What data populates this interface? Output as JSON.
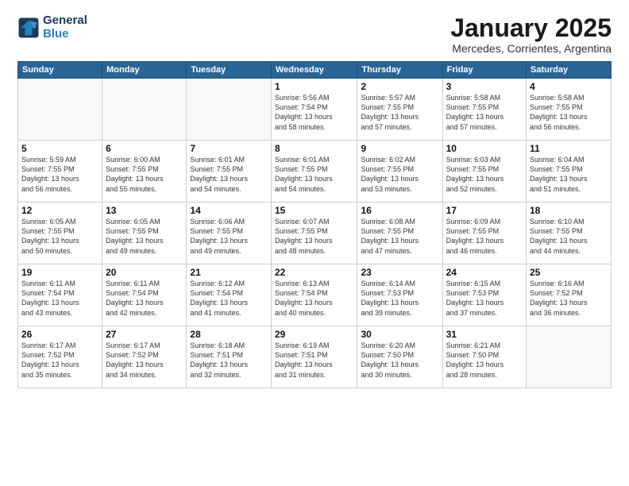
{
  "logo": {
    "line1": "General",
    "line2": "Blue"
  },
  "header": {
    "title": "January 2025",
    "subtitle": "Mercedes, Corrientes, Argentina"
  },
  "weekdays": [
    "Sunday",
    "Monday",
    "Tuesday",
    "Wednesday",
    "Thursday",
    "Friday",
    "Saturday"
  ],
  "weeks": [
    [
      {
        "day": "",
        "info": ""
      },
      {
        "day": "",
        "info": ""
      },
      {
        "day": "",
        "info": ""
      },
      {
        "day": "1",
        "info": "Sunrise: 5:56 AM\nSunset: 7:54 PM\nDaylight: 13 hours\nand 58 minutes."
      },
      {
        "day": "2",
        "info": "Sunrise: 5:57 AM\nSunset: 7:55 PM\nDaylight: 13 hours\nand 57 minutes."
      },
      {
        "day": "3",
        "info": "Sunrise: 5:58 AM\nSunset: 7:55 PM\nDaylight: 13 hours\nand 57 minutes."
      },
      {
        "day": "4",
        "info": "Sunrise: 5:58 AM\nSunset: 7:55 PM\nDaylight: 13 hours\nand 56 minutes."
      }
    ],
    [
      {
        "day": "5",
        "info": "Sunrise: 5:59 AM\nSunset: 7:55 PM\nDaylight: 13 hours\nand 56 minutes."
      },
      {
        "day": "6",
        "info": "Sunrise: 6:00 AM\nSunset: 7:55 PM\nDaylight: 13 hours\nand 55 minutes."
      },
      {
        "day": "7",
        "info": "Sunrise: 6:01 AM\nSunset: 7:55 PM\nDaylight: 13 hours\nand 54 minutes."
      },
      {
        "day": "8",
        "info": "Sunrise: 6:01 AM\nSunset: 7:55 PM\nDaylight: 13 hours\nand 54 minutes."
      },
      {
        "day": "9",
        "info": "Sunrise: 6:02 AM\nSunset: 7:55 PM\nDaylight: 13 hours\nand 53 minutes."
      },
      {
        "day": "10",
        "info": "Sunrise: 6:03 AM\nSunset: 7:55 PM\nDaylight: 13 hours\nand 52 minutes."
      },
      {
        "day": "11",
        "info": "Sunrise: 6:04 AM\nSunset: 7:55 PM\nDaylight: 13 hours\nand 51 minutes."
      }
    ],
    [
      {
        "day": "12",
        "info": "Sunrise: 6:05 AM\nSunset: 7:55 PM\nDaylight: 13 hours\nand 50 minutes."
      },
      {
        "day": "13",
        "info": "Sunrise: 6:05 AM\nSunset: 7:55 PM\nDaylight: 13 hours\nand 49 minutes."
      },
      {
        "day": "14",
        "info": "Sunrise: 6:06 AM\nSunset: 7:55 PM\nDaylight: 13 hours\nand 49 minutes."
      },
      {
        "day": "15",
        "info": "Sunrise: 6:07 AM\nSunset: 7:55 PM\nDaylight: 13 hours\nand 48 minutes."
      },
      {
        "day": "16",
        "info": "Sunrise: 6:08 AM\nSunset: 7:55 PM\nDaylight: 13 hours\nand 47 minutes."
      },
      {
        "day": "17",
        "info": "Sunrise: 6:09 AM\nSunset: 7:55 PM\nDaylight: 13 hours\nand 46 minutes."
      },
      {
        "day": "18",
        "info": "Sunrise: 6:10 AM\nSunset: 7:55 PM\nDaylight: 13 hours\nand 44 minutes."
      }
    ],
    [
      {
        "day": "19",
        "info": "Sunrise: 6:11 AM\nSunset: 7:54 PM\nDaylight: 13 hours\nand 43 minutes."
      },
      {
        "day": "20",
        "info": "Sunrise: 6:11 AM\nSunset: 7:54 PM\nDaylight: 13 hours\nand 42 minutes."
      },
      {
        "day": "21",
        "info": "Sunrise: 6:12 AM\nSunset: 7:54 PM\nDaylight: 13 hours\nand 41 minutes."
      },
      {
        "day": "22",
        "info": "Sunrise: 6:13 AM\nSunset: 7:54 PM\nDaylight: 13 hours\nand 40 minutes."
      },
      {
        "day": "23",
        "info": "Sunrise: 6:14 AM\nSunset: 7:53 PM\nDaylight: 13 hours\nand 39 minutes."
      },
      {
        "day": "24",
        "info": "Sunrise: 6:15 AM\nSunset: 7:53 PM\nDaylight: 13 hours\nand 37 minutes."
      },
      {
        "day": "25",
        "info": "Sunrise: 6:16 AM\nSunset: 7:52 PM\nDaylight: 13 hours\nand 36 minutes."
      }
    ],
    [
      {
        "day": "26",
        "info": "Sunrise: 6:17 AM\nSunset: 7:52 PM\nDaylight: 13 hours\nand 35 minutes."
      },
      {
        "day": "27",
        "info": "Sunrise: 6:17 AM\nSunset: 7:52 PM\nDaylight: 13 hours\nand 34 minutes."
      },
      {
        "day": "28",
        "info": "Sunrise: 6:18 AM\nSunset: 7:51 PM\nDaylight: 13 hours\nand 32 minutes."
      },
      {
        "day": "29",
        "info": "Sunrise: 6:19 AM\nSunset: 7:51 PM\nDaylight: 13 hours\nand 31 minutes."
      },
      {
        "day": "30",
        "info": "Sunrise: 6:20 AM\nSunset: 7:50 PM\nDaylight: 13 hours\nand 30 minutes."
      },
      {
        "day": "31",
        "info": "Sunrise: 6:21 AM\nSunset: 7:50 PM\nDaylight: 13 hours\nand 28 minutes."
      },
      {
        "day": "",
        "info": ""
      }
    ]
  ]
}
